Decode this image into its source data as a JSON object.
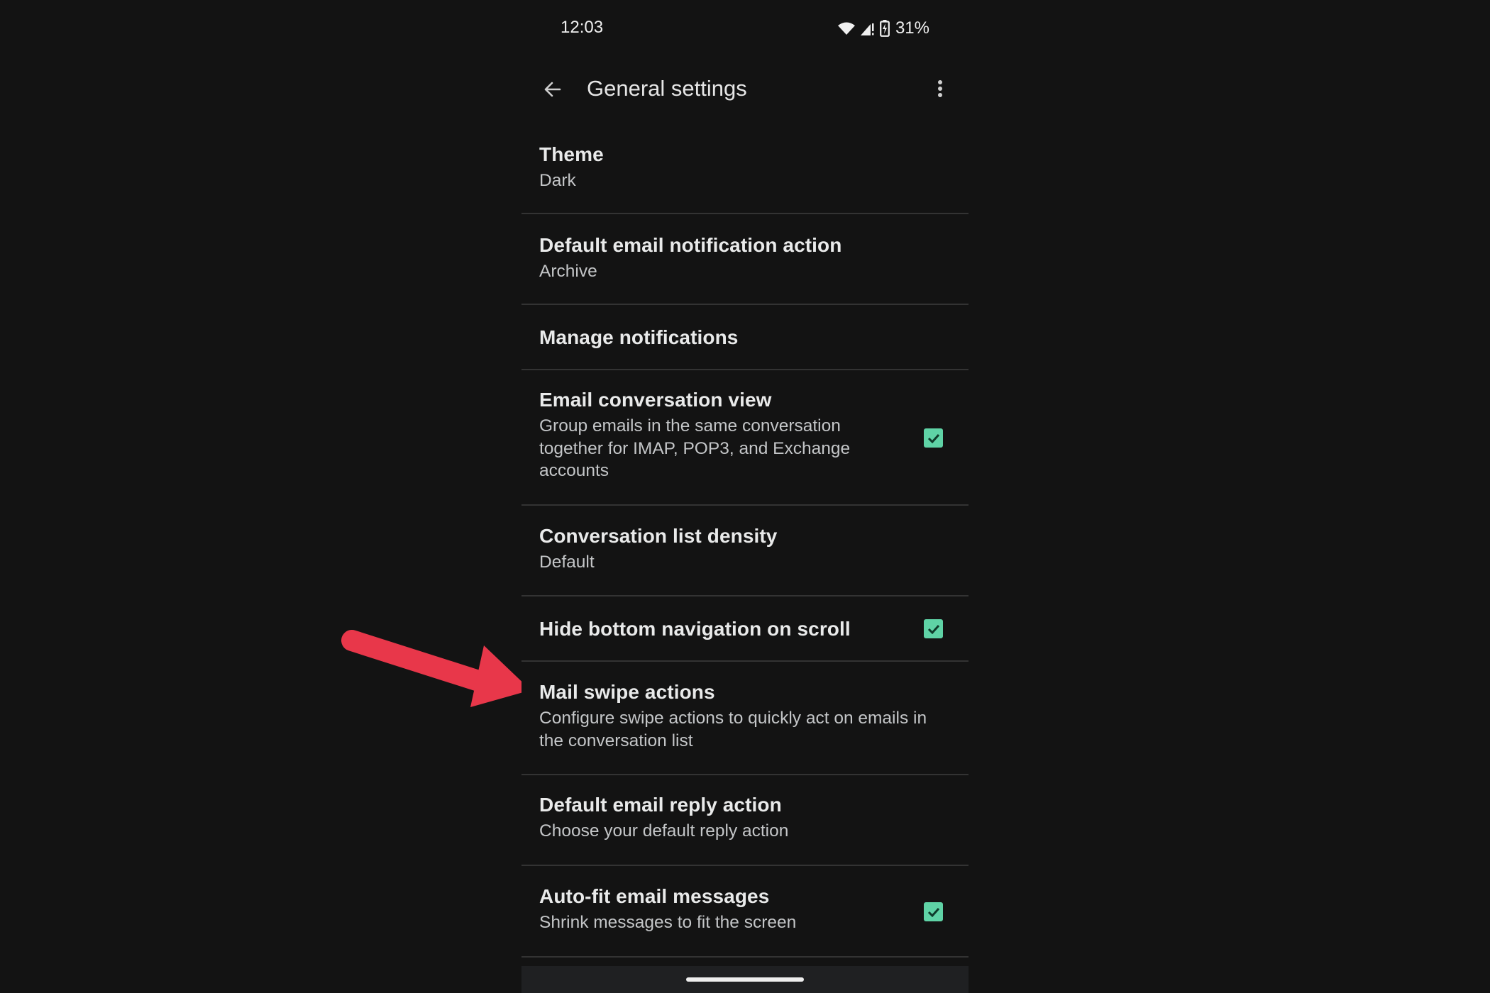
{
  "status_bar": {
    "time": "12:03",
    "battery_percent": "31%",
    "icons": [
      "wifi-icon",
      "cell-signal-icon",
      "battery-charging-icon"
    ]
  },
  "app_bar": {
    "title": "General settings",
    "back_icon": "arrow-back-icon",
    "menu_icon": "more-vert-icon"
  },
  "settings": [
    {
      "title": "Theme",
      "subtitle": "Dark",
      "checkbox": null
    },
    {
      "title": "Default email notification action",
      "subtitle": "Archive",
      "checkbox": null
    },
    {
      "title": "Manage notifications",
      "subtitle": null,
      "checkbox": null
    },
    {
      "title": "Email conversation view",
      "subtitle": "Group emails in the same conversation together for IMAP, POP3, and Exchange accounts",
      "checkbox": true
    },
    {
      "title": "Conversation list density",
      "subtitle": "Default",
      "checkbox": null
    },
    {
      "title": "Hide bottom navigation on scroll",
      "subtitle": null,
      "checkbox": true
    },
    {
      "title": "Mail swipe actions",
      "subtitle": "Configure swipe actions to quickly act on emails in the conversation list",
      "checkbox": null
    },
    {
      "title": "Default email reply action",
      "subtitle": "Choose your default reply action",
      "checkbox": null
    },
    {
      "title": "Auto-fit email messages",
      "subtitle": "Shrink messages to fit the screen",
      "checkbox": true
    }
  ],
  "annotation": {
    "type": "arrow",
    "points_to": "Mail swipe actions",
    "color": "#e8374a"
  },
  "colors": {
    "background": "#131313",
    "checkbox": "#5fd3a6",
    "divider": "#333333",
    "navbar": "#1f2022"
  }
}
